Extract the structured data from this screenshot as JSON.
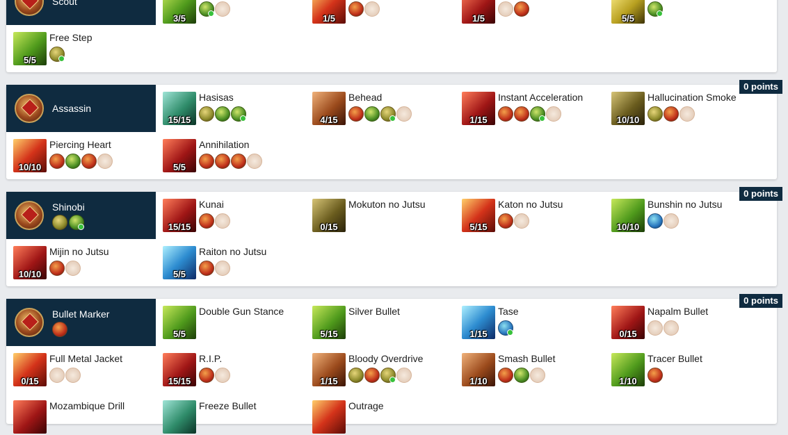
{
  "sections": [
    {
      "name": "Scout",
      "skills": [
        {
          "name": "",
          "level": "3/5"
        },
        {
          "name": "",
          "level": "1/5"
        },
        {
          "name": "",
          "level": "1/5"
        },
        {
          "name": "",
          "level": "5/5"
        },
        {
          "name": "Free Step",
          "level": "5/5"
        }
      ]
    },
    {
      "name": "Assassin",
      "points": "0 points",
      "skills": [
        {
          "name": "Hasisas",
          "level": "15/15"
        },
        {
          "name": "Behead",
          "level": "4/15"
        },
        {
          "name": "Instant Acceleration",
          "level": "1/15"
        },
        {
          "name": "Hallucination Smoke",
          "level": "10/10"
        },
        {
          "name": "Piercing Heart",
          "level": "10/10"
        },
        {
          "name": "Annihilation",
          "level": "5/5"
        }
      ]
    },
    {
      "name": "Shinobi",
      "points": "0 points",
      "skills": [
        {
          "name": "Kunai",
          "level": "15/15"
        },
        {
          "name": "Mokuton no Jutsu",
          "level": "0/15"
        },
        {
          "name": "Katon no Jutsu",
          "level": "5/15"
        },
        {
          "name": "Bunshin no Jutsu",
          "level": "10/10"
        },
        {
          "name": "Mijin no Jutsu",
          "level": "10/10"
        },
        {
          "name": "Raiton no Jutsu",
          "level": "5/5"
        }
      ]
    },
    {
      "name": "Bullet Marker",
      "points": "0 points",
      "skills": [
        {
          "name": "Double Gun Stance",
          "level": "5/5"
        },
        {
          "name": "Silver Bullet",
          "level": "5/15"
        },
        {
          "name": "Tase",
          "level": "1/15"
        },
        {
          "name": "Napalm Bullet",
          "level": "0/15"
        },
        {
          "name": "Full Metal Jacket",
          "level": "0/15"
        },
        {
          "name": "R.I.P.",
          "level": "15/15"
        },
        {
          "name": "Bloody Overdrive",
          "level": "1/15"
        },
        {
          "name": "Smash Bullet",
          "level": "1/10"
        },
        {
          "name": "Tracer Bullet",
          "level": "1/10"
        },
        {
          "name": "Mozambique Drill",
          "level": ""
        },
        {
          "name": "Freeze Bullet",
          "level": ""
        },
        {
          "name": "Outrage",
          "level": ""
        }
      ]
    }
  ]
}
